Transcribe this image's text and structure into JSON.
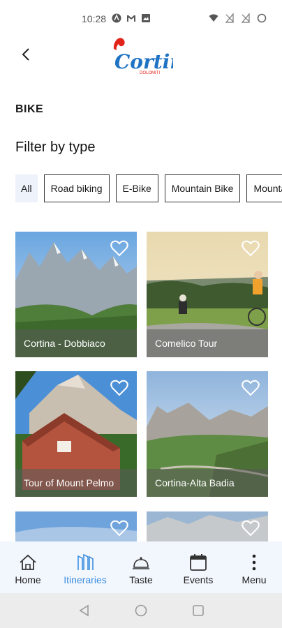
{
  "status_bar": {
    "time": "10:28"
  },
  "header": {
    "logo_text": "Cortina",
    "logo_subtext": "DOLOMITI"
  },
  "section_title": "BIKE",
  "filter": {
    "title": "Filter by type",
    "chips": [
      {
        "label": "All",
        "active": true
      },
      {
        "label": "Road biking",
        "active": false
      },
      {
        "label": "E-Bike",
        "active": false
      },
      {
        "label": "Mountain Bike",
        "active": false
      },
      {
        "label": "Mounta",
        "active": false
      }
    ]
  },
  "itineraries": [
    {
      "title": "Cortina - Dobbiaco"
    },
    {
      "title": "Comelico Tour"
    },
    {
      "title": "Tour of Mount Pelmo"
    },
    {
      "title": "Cortina-Alta Badia"
    },
    {
      "title": ""
    },
    {
      "title": ""
    }
  ],
  "bottom_nav": {
    "items": [
      {
        "label": "Home",
        "icon": "home-icon"
      },
      {
        "label": "Itineraries",
        "icon": "itineraries-icon",
        "active": true
      },
      {
        "label": "Taste",
        "icon": "cloche-icon"
      },
      {
        "label": "Events",
        "icon": "calendar-icon"
      },
      {
        "label": "Menu",
        "icon": "more-vertical-icon"
      }
    ]
  },
  "colors": {
    "accent": "#3d8fe0",
    "logo_red": "#e2231a",
    "logo_blue": "#1f73c4",
    "nav_bg": "#f2f6fd",
    "chip_active_bg": "#eef2fb"
  }
}
